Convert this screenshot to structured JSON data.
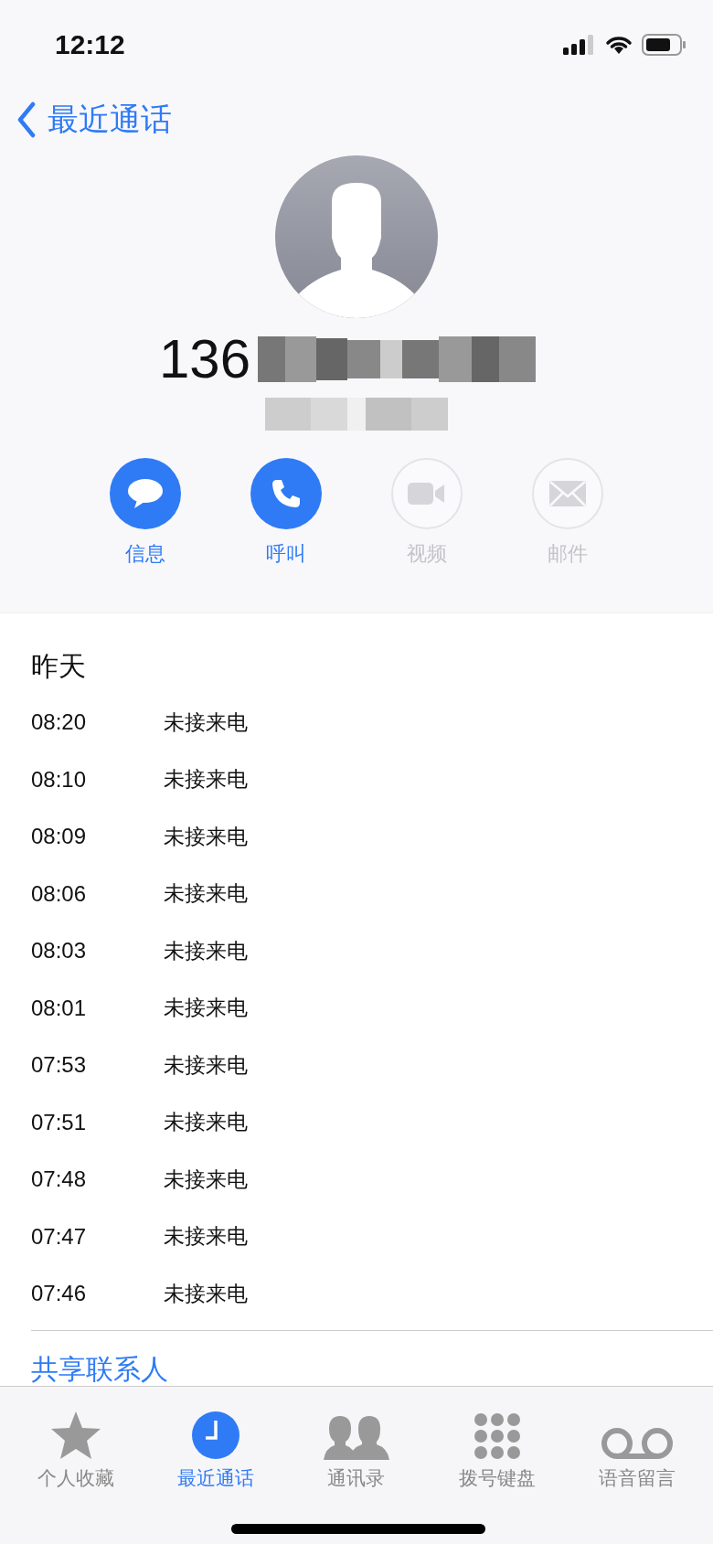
{
  "status_bar": {
    "time": "12:12"
  },
  "nav": {
    "back_label": "最近通话"
  },
  "contact": {
    "number_visible": "136"
  },
  "actions": [
    {
      "kind": "message",
      "label": "信息",
      "disabled": false
    },
    {
      "kind": "call",
      "label": "呼叫",
      "disabled": false
    },
    {
      "kind": "video",
      "label": "视频",
      "disabled": true
    },
    {
      "kind": "mail",
      "label": "邮件",
      "disabled": true
    }
  ],
  "history": {
    "day": "昨天",
    "calls": [
      {
        "time": "08:20",
        "type": "未接来电"
      },
      {
        "time": "08:10",
        "type": "未接来电"
      },
      {
        "time": "08:09",
        "type": "未接来电"
      },
      {
        "time": "08:06",
        "type": "未接来电"
      },
      {
        "time": "08:03",
        "type": "未接来电"
      },
      {
        "time": "08:01",
        "type": "未接来电"
      },
      {
        "time": "07:53",
        "type": "未接来电"
      },
      {
        "time": "07:51",
        "type": "未接来电"
      },
      {
        "time": "07:48",
        "type": "未接来电"
      },
      {
        "time": "07:47",
        "type": "未接来电"
      },
      {
        "time": "07:46",
        "type": "未接来电"
      }
    ]
  },
  "share_contact": "共享联系人",
  "tab_bar": [
    {
      "kind": "favorites",
      "label": "个人收藏",
      "selected": false
    },
    {
      "kind": "recents",
      "label": "最近通话",
      "selected": true
    },
    {
      "kind": "contacts",
      "label": "通讯录",
      "selected": false
    },
    {
      "kind": "keypad",
      "label": "拨号键盘",
      "selected": false
    },
    {
      "kind": "voicemail",
      "label": "语音留言",
      "selected": false
    }
  ]
}
